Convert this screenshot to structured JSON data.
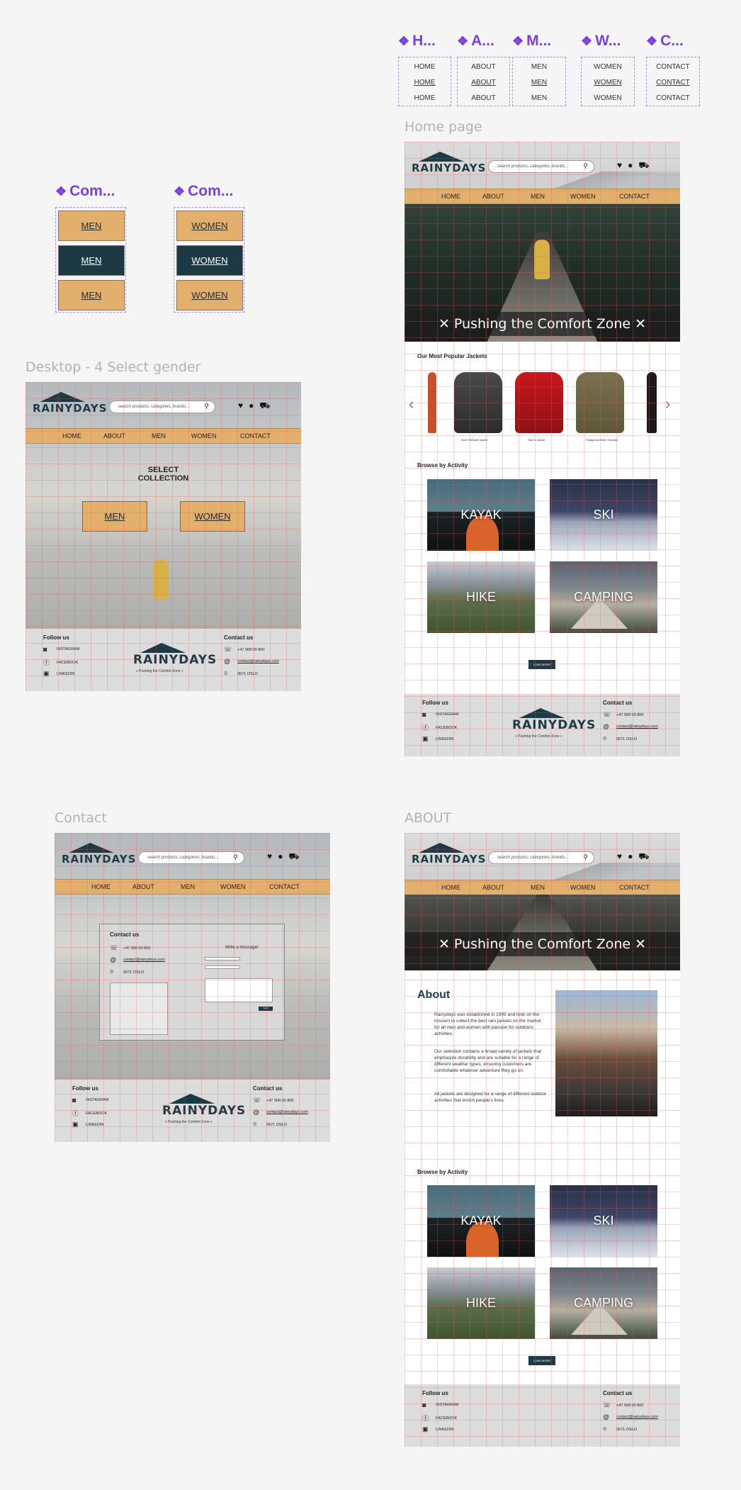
{
  "components": {
    "nav_sets": [
      {
        "title": "H...",
        "labels": [
          "HOME",
          "HOME",
          "HOME"
        ]
      },
      {
        "title": "A...",
        "labels": [
          "ABOUT",
          "ABOUT",
          "ABOUT"
        ]
      },
      {
        "title": "M...",
        "labels": [
          "MEN",
          "MEN",
          "MEN"
        ]
      },
      {
        "title": "W...",
        "labels": [
          "WOMEN",
          "WOMEN",
          "WOMEN"
        ]
      },
      {
        "title": "C...",
        "labels": [
          "CONTACT",
          "CONTACT",
          "CONTACT"
        ]
      }
    ],
    "btn_sets": [
      {
        "title": "Com...",
        "labels": [
          "MEN",
          "MEN",
          "MEN"
        ]
      },
      {
        "title": "Com...",
        "labels": [
          "WOMEN",
          "WOMEN",
          "WOMEN"
        ]
      }
    ]
  },
  "labels": {
    "home": "Home page",
    "desktop4": "Desktop - 4 Select gender",
    "contact": "Contact",
    "about": "ABOUT"
  },
  "header": {
    "logo": "RAINYDAYS",
    "search_placeholder": "search products, categories, brands...",
    "nav": [
      "HOME",
      "ABOUT",
      "MEN",
      "WOMEN",
      "CONTACT"
    ]
  },
  "hero": {
    "banner": "✕ Pushing the Comfort Zone ✕"
  },
  "home": {
    "popular_title": "Our Most Popular Jackets",
    "jackets": [
      "Arch Softshell Jacket",
      "Rab In Jacket",
      "Patagonia Better Sweater"
    ],
    "browse_title": "Browse by Activity",
    "activities": [
      "KAYAK",
      "SKI",
      "HIKE",
      "CAMPING"
    ],
    "load_more": "LOAD MORE"
  },
  "select": {
    "title_line1": "SELECT",
    "title_line2": "COLLECTION",
    "men": "MEN",
    "women": "WOMEN"
  },
  "contact_form": {
    "title": "Contact us",
    "phone": "+47 908 00 800",
    "email": "contact@rainydays.com",
    "address": "0671 OSLO",
    "write": "Write a message!",
    "send": "Send"
  },
  "about": {
    "title": "About",
    "p1": "Rainydays was established in 1995 and took on the mission to collect the best rain jackets on the market for all men and women with passion for outdoors activities.",
    "p2": "Our selection contains a broad variety of jackets that emphasize durability and are suitable for a range of different weather types, ensuring customers are comfortable whatever adventure they go on.",
    "p3": "All jackets are designed for a range of different outdoor activities that enrich people's lives."
  },
  "footer": {
    "follow": "Follow us",
    "social": [
      "INSTAGRAM",
      "FACEBOOK",
      "LINKEDIN"
    ],
    "contact": "Contact us",
    "phone": "+47 908 00 800",
    "email": "contact@rainydays.com",
    "address": "0671 OSLO",
    "tagline": "« Pushing the Comfort Zone »"
  },
  "colors": {
    "accent": "#e2b06c",
    "dark": "#1d3943",
    "component": "#7b3fe0"
  }
}
